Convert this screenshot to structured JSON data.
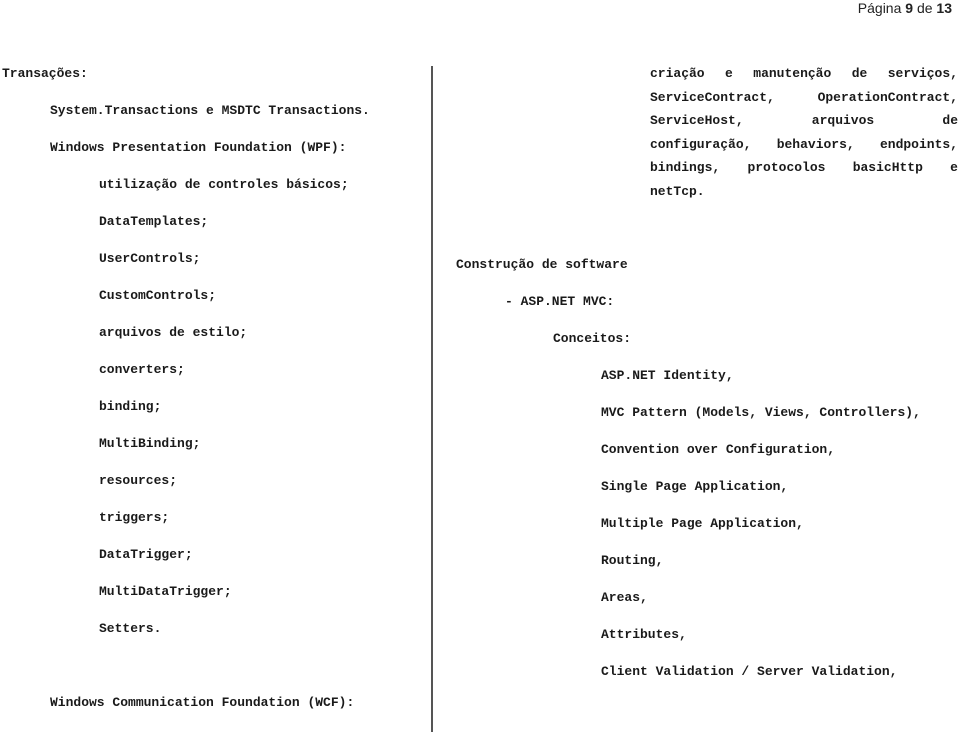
{
  "header": {
    "page_label": "Página",
    "current_page": "9",
    "of_label": "de",
    "total_pages": "13"
  },
  "left_column": {
    "transactions_heading": "Transações:",
    "transactions_item": "System.Transactions e MSDTC Transactions.",
    "wpf_heading": "Windows Presentation Foundation (WPF):",
    "wpf_items": [
      "utilização de controles básicos;",
      "DataTemplates;",
      "UserControls;",
      "CustomControls;",
      "arquivos de estilo;",
      "converters;",
      "binding;",
      "MultiBinding;",
      "resources;",
      "triggers;",
      "DataTrigger;",
      "MultiDataTrigger;",
      "Setters."
    ],
    "wcf_heading": "Windows Communication Foundation (WCF):"
  },
  "right_column": {
    "wcf_paragraph_lines": [
      [
        "criação",
        "e",
        "manutenção",
        "de",
        "serviços,"
      ],
      [
        "ServiceContract,",
        "OperationContract,"
      ],
      [
        "ServiceHost,",
        "arquivos",
        "de"
      ],
      [
        "configuração,",
        "behaviors,",
        "endpoints,"
      ],
      [
        "bindings,",
        "protocolos",
        "basicHttp",
        "e"
      ],
      [
        "netTcp."
      ]
    ],
    "construction_heading": "Construção de software",
    "aspnet_heading": "- ASP.NET MVC:",
    "concepts_heading": "Conceitos:",
    "concepts": [
      "ASP.NET Identity,",
      "MVC Pattern (Models, Views, Controllers),",
      "Convention over Configuration,",
      "Single Page Application,",
      "Multiple Page Application,",
      "Routing,",
      "Areas,",
      "Attributes,",
      "Client Validation / Server Validation,"
    ]
  }
}
